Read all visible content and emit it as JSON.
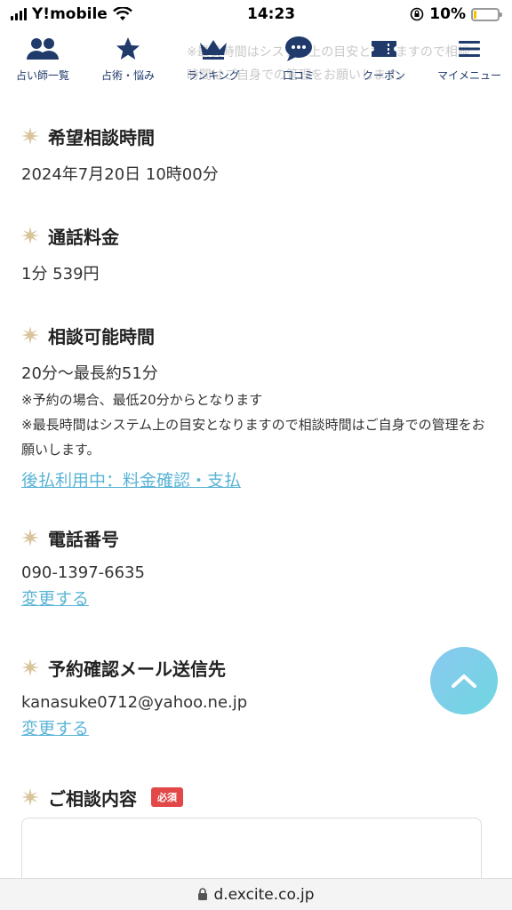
{
  "status": {
    "carrier": "Y!mobile",
    "time": "14:23",
    "battery": "10%",
    "battery_level": 0.1
  },
  "nav": {
    "background_text": "※最長時間はシステム上の目安となりますので相談\n時間はご自身での管理をお願いします。",
    "items": [
      {
        "label": "占い師一覧",
        "icon": "users-icon"
      },
      {
        "label": "占術・悩み",
        "icon": "star-icon"
      },
      {
        "label": "ランキング",
        "icon": "crown-icon"
      },
      {
        "label": "口コミ",
        "icon": "chat-bubble-icon"
      },
      {
        "label": "クーポン",
        "icon": "ticket-icon"
      },
      {
        "label": "マイメニュー",
        "icon": "hamburger-icon"
      }
    ]
  },
  "sections": {
    "desired_time": {
      "title": "希望相談時間",
      "value": "2024年7月20日 10時00分"
    },
    "call_fee": {
      "title": "通話料金",
      "value": "1分 539円"
    },
    "available_time": {
      "title": "相談可能時間",
      "value": "20分〜最長約51分",
      "note1": "※予約の場合、最低20分からとなります",
      "note2": "※最長時間はシステム上の目安となりますので相談時間はご自身での管理をお願いします。",
      "link": "後払利用中：料金確認・支払"
    },
    "phone": {
      "title": "電話番号",
      "value": "090-1397-6635",
      "link": "変更する"
    },
    "email": {
      "title": "予約確認メール送信先",
      "value": "kanasuke0712@yahoo.ne.jp",
      "link": "変更する"
    },
    "consult": {
      "title": "ご相談内容",
      "badge": "必須"
    }
  },
  "url_bar": {
    "domain": "d.excite.co.jp"
  },
  "colors": {
    "nav": "#1f3a6b",
    "link": "#5ab4d6",
    "badge": "#e24848",
    "star": "#d9c39a"
  }
}
